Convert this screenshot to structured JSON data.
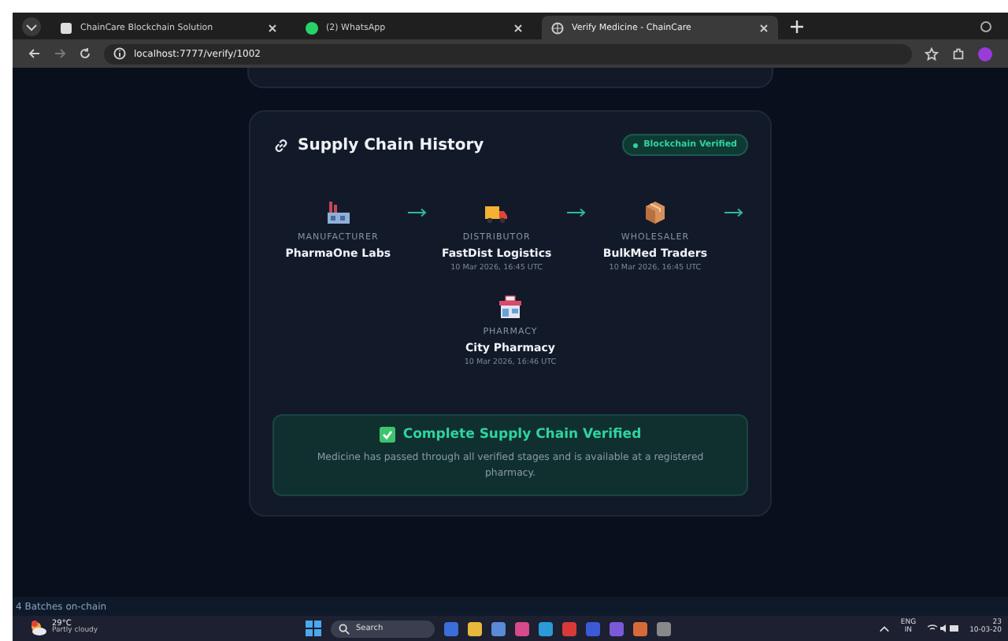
{
  "browser": {
    "tabs": [
      {
        "title": "ChainCare Blockchain Solution",
        "selected": false,
        "kind": "doc"
      },
      {
        "title": "(2) WhatsApp",
        "selected": false,
        "kind": "chat"
      },
      {
        "title": "Verify Medicine - ChainCare",
        "selected": true,
        "kind": "globe"
      }
    ],
    "url": "localhost:7777/verify/1002"
  },
  "card": {
    "title": "Supply Chain History",
    "badge": "Blockchain Verified",
    "stages": [
      {
        "kind": "factory",
        "role": "MANUFACTURER",
        "name": "PharmaOne Labs"
      },
      {
        "kind": "truck",
        "role": "DISTRIBUTOR",
        "name": "FastDist Logistics",
        "time": "10 Mar 2026, 16:45 UTC"
      },
      {
        "kind": "box",
        "role": "WHOLESALER",
        "name": "BulkMed Traders",
        "time": "10 Mar 2026, 16:45 UTC"
      },
      {
        "kind": "shop",
        "role": "PHARMACY",
        "name": "City Pharmacy",
        "time": "10 Mar 2026, 16:46 UTC"
      }
    ],
    "summary": {
      "title": "Complete Supply Chain Verified",
      "text": "Medicine has passed through all verified stages and is available at a registered pharmacy."
    }
  },
  "status_text": "4 Batches on-chain",
  "taskbar": {
    "temperature": "29°C",
    "weather": "Partly cloudy",
    "search": "Search",
    "lang": "ENG",
    "region": "IN",
    "time": "23",
    "date": "10-03-20"
  }
}
